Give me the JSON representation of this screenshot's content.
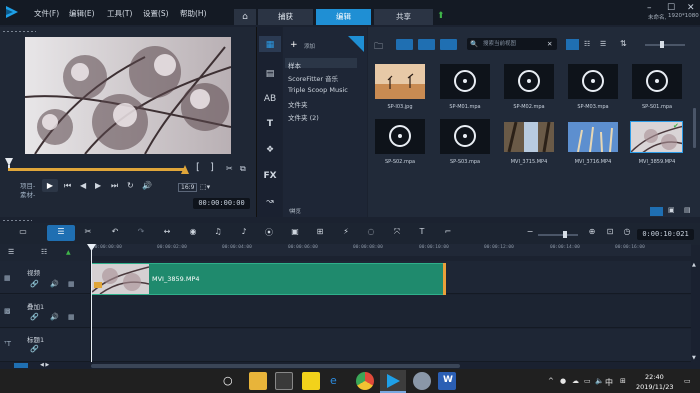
{
  "menu": [
    "文件(F)",
    "编辑(E)",
    "工具(T)",
    "设置(S)",
    "帮助(H)"
  ],
  "workspace_tabs": [
    {
      "label": "捕获",
      "active": false
    },
    {
      "label": "编辑",
      "active": true
    },
    {
      "label": "共享",
      "active": false
    }
  ],
  "status_right": {
    "project": "未命名,",
    "resolution": "1920*1080"
  },
  "preview": {
    "mode_project": "项目-",
    "mode_clip": "素材-",
    "aspect": "16:9",
    "timecode": "00:00:00:00"
  },
  "library": {
    "add_label": "添加",
    "tree": [
      "样本",
      "ScoreFitter 音乐",
      "Triple Scoop Music",
      "文件夹",
      "文件夹 (2)"
    ],
    "browse_label": "浏览",
    "search_placeholder": "搜索当前视图"
  },
  "media": [
    {
      "name": "SP-I03.jpg",
      "kind": "image"
    },
    {
      "name": "SP-M01.mpa",
      "kind": "music"
    },
    {
      "name": "SP-M02.mpa",
      "kind": "music"
    },
    {
      "name": "SP-M03.mpa",
      "kind": "music"
    },
    {
      "name": "SP-S01.mpa",
      "kind": "music"
    },
    {
      "name": "SP-S02.mpa",
      "kind": "music"
    },
    {
      "name": "SP-S03.mpa",
      "kind": "music"
    },
    {
      "name": "MVI_3715.MP4",
      "kind": "video"
    },
    {
      "name": "MVI_3716.MP4",
      "kind": "video"
    },
    {
      "name": "MVI_3859.MP4",
      "kind": "video"
    }
  ],
  "timeline": {
    "timecode": "0:00:10:021",
    "ruler": [
      "00:00:00:00",
      "00:00:02:00",
      "00:00:04:00",
      "00:00:06:00",
      "00:00:08:00",
      "00:00:10:00",
      "00:00:12:00",
      "00:00:14:00",
      "00:00:16:00"
    ],
    "tracks": [
      {
        "name": "视频",
        "icon": "video-track-icon"
      },
      {
        "name": "叠加1",
        "icon": "overlay-track-icon"
      },
      {
        "name": "标题1",
        "icon": "title-track-icon"
      }
    ],
    "clip_label": "MVI_3859.MP4"
  },
  "taskbar": {
    "time": "22:40",
    "date": "2019/11/23",
    "ime": "中"
  },
  "colors": {
    "accent": "#1f8fd4",
    "clip": "#1f8a6d",
    "scrub": "#e0a63a"
  }
}
